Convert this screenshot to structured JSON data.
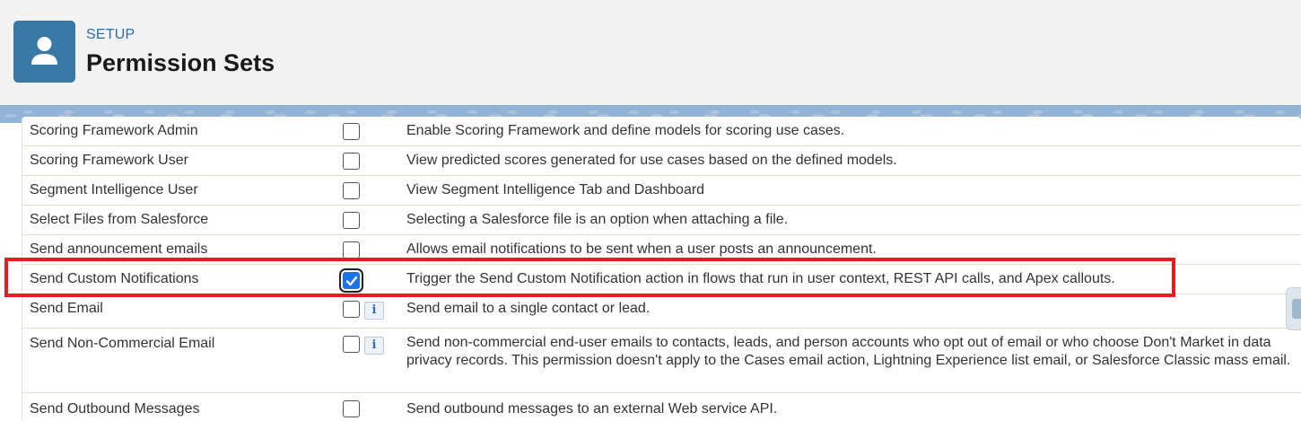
{
  "header": {
    "setup_label": "SETUP",
    "title": "Permission Sets",
    "icon": "user-icon",
    "icon_color": "#3a78a6"
  },
  "highlight_color": "#e02020",
  "checkbox_checked_color": "#1a73e8",
  "rows": [
    {
      "name": "Scoring Framework Admin",
      "checked": false,
      "info": false,
      "description": "Enable Scoring Framework and define models for scoring use cases."
    },
    {
      "name": "Scoring Framework User",
      "checked": false,
      "info": false,
      "description": "View predicted scores generated for use cases based on the defined models."
    },
    {
      "name": "Segment Intelligence User",
      "checked": false,
      "info": false,
      "description": "View Segment Intelligence Tab and Dashboard"
    },
    {
      "name": "Select Files from Salesforce",
      "checked": false,
      "info": false,
      "description": "Selecting a Salesforce file is an option when attaching a file."
    },
    {
      "name": "Send announcement emails",
      "checked": false,
      "info": false,
      "description": "Allows email notifications to be sent when a user posts an announcement."
    },
    {
      "name": "Send Custom Notifications",
      "checked": true,
      "info": false,
      "description": "Trigger the Send Custom Notification action in flows that run in user context, REST API calls, and Apex callouts."
    },
    {
      "name": "Send Email",
      "checked": false,
      "info": true,
      "description": "Send email to a single contact or lead."
    },
    {
      "name": "Send Non-Commercial Email",
      "checked": false,
      "info": true,
      "description": "Send non-commercial end-user emails to contacts, leads, and person accounts who opt out of email or who choose Don't Market in data privacy records. This permission doesn't apply to the Cases email action, Lightning Experience list email, or Salesforce Classic mass email."
    },
    {
      "name": "Send Outbound Messages",
      "checked": false,
      "info": false,
      "description": "Send outbound messages to an external Web service API."
    }
  ],
  "info_glyph": "i"
}
